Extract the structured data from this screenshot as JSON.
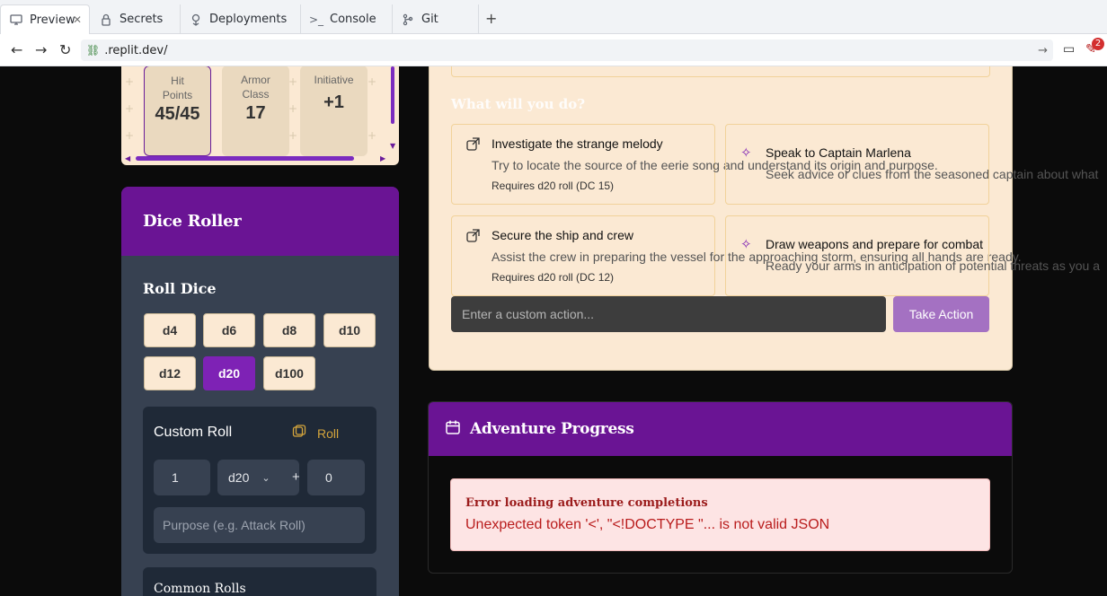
{
  "tabs": [
    {
      "label": "Preview",
      "icon": "monitor-icon"
    },
    {
      "label": "Secrets",
      "icon": "lock-icon"
    },
    {
      "label": "Deployments",
      "icon": "deploy-icon"
    },
    {
      "label": "Console",
      "icon": "terminal-icon"
    },
    {
      "label": "Git",
      "icon": "git-icon"
    }
  ],
  "address": {
    "url": ".replit.dev/",
    "badge_count": "2"
  },
  "stats": [
    {
      "label": "Hit Points",
      "value": "45/45"
    },
    {
      "label": "Armor Class",
      "value": "17"
    },
    {
      "label": "Initiative",
      "value": "+1"
    }
  ],
  "dice_roller": {
    "title": "Dice Roller",
    "roll_title": "Roll Dice",
    "dice": [
      "d4",
      "d6",
      "d8",
      "d10",
      "d12",
      "d20",
      "d100"
    ],
    "selected": "d20",
    "custom": {
      "title": "Custom Roll",
      "roll_label": "Roll",
      "count": "1",
      "die": "d20",
      "plus": "+",
      "modifier": "0",
      "purpose_placeholder": "Purpose (e.g. Attack Roll)"
    },
    "common_title": "Common Rolls"
  },
  "scenario": {
    "question": "What will you do?",
    "options": [
      {
        "title": "Investigate the strange melody",
        "desc": "Try to locate the source of the eerie song and understand its origin and purpose.",
        "req": "Requires d20 roll (DC 15)"
      },
      {
        "title": "Speak to Captain Marlena",
        "desc": "Seek advice or clues from the seasoned captain about what"
      },
      {
        "title": "Secure the ship and crew",
        "desc": "Assist the crew in preparing the vessel for the approaching storm, ensuring all hands are ready.",
        "req": "Requires d20 roll (DC 12)"
      },
      {
        "title": "Draw weapons and prepare for combat",
        "desc": "Ready your arms in anticipation of potential threats as you a"
      }
    ],
    "custom_placeholder": "Enter a custom action...",
    "take_action": "Take Action"
  },
  "progress": {
    "title": "Adventure Progress",
    "error_title": "Error loading adventure completions",
    "error_message": "Unexpected token '<', \"<!DOCTYPE \"... is not valid JSON"
  }
}
